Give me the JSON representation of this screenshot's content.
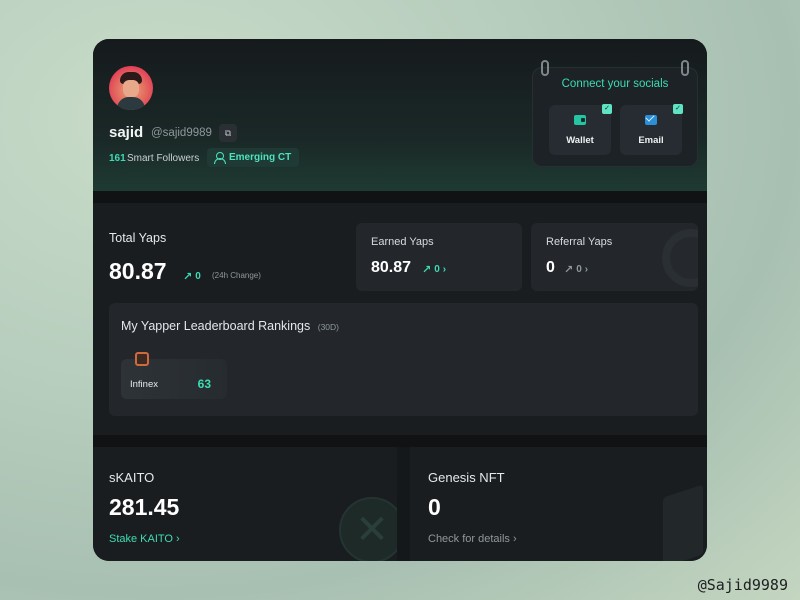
{
  "profile": {
    "username": "sajid",
    "handle": "@sajid9989",
    "smart_followers_count": "161",
    "smart_followers_label": "Smart Followers",
    "badge": "Emerging CT"
  },
  "socials": {
    "title": "Connect your socials",
    "wallet_label": "Wallet",
    "email_label": "Email"
  },
  "stats": {
    "total_yaps_label": "Total Yaps",
    "total_yaps_value": "80.87",
    "total_yaps_change": "0",
    "change_note": "(24h Change)",
    "earned_yaps_label": "Earned Yaps",
    "earned_yaps_value": "80.87",
    "earned_yaps_change": "0",
    "referral_yaps_label": "Referral Yaps",
    "referral_yaps_value": "0",
    "referral_yaps_change": "0"
  },
  "leaderboard": {
    "title": "My Yapper Leaderboard Rankings",
    "period": "(30D)",
    "entries": [
      {
        "name": "Infinex",
        "rank": "63"
      }
    ]
  },
  "skaito": {
    "label": "sKAITO",
    "value": "281.45",
    "link": "Stake KAITO"
  },
  "genesis": {
    "label": "Genesis NFT",
    "value": "0",
    "link": "Check for details"
  },
  "watermark": "@Sajid9989",
  "colors": {
    "accent": "#3ddbb3",
    "card_bg": "#15181b",
    "panel_bg": "#23272b"
  }
}
